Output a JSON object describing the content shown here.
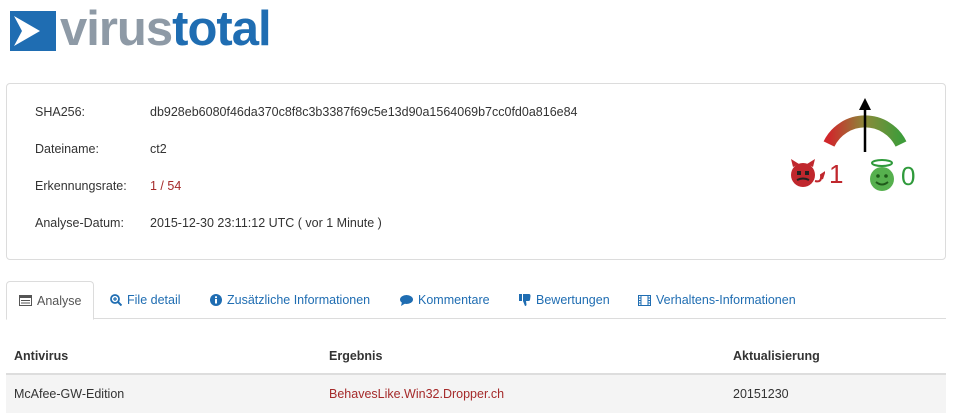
{
  "logo": {
    "text_virus": "virus",
    "text_total": "total"
  },
  "summary": {
    "sha256_label": "SHA256:",
    "sha256_value": "db928eb6080f46da370c8f8c3b3387f69c5e13d90a1564069b7cc0fd0a816e84",
    "filename_label": "Dateiname:",
    "filename_value": "ct2",
    "ratio_label": "Erkennungsrate:",
    "ratio_value": "1 / 54",
    "date_label": "Analyse-Datum:",
    "date_value": "2015-12-30 23:11:12 UTC ( vor 1 Minute )"
  },
  "community": {
    "malicious_votes": "1",
    "harmless_votes": "0",
    "colors": {
      "bad": "#c0272d",
      "good": "#2f9a3b"
    }
  },
  "tabs": [
    {
      "label": "Analyse",
      "icon": "list-icon",
      "active": true
    },
    {
      "label": "File detail",
      "icon": "zoom-icon"
    },
    {
      "label": "Zusätzliche Informationen",
      "icon": "info-icon"
    },
    {
      "label": "Kommentare",
      "icon": "comment-icon"
    },
    {
      "label": "Bewertungen",
      "icon": "thumbs-down-icon"
    },
    {
      "label": "Verhaltens-Informationen",
      "icon": "film-icon"
    }
  ],
  "table": {
    "headers": [
      "Antivirus",
      "Ergebnis",
      "Aktualisierung"
    ],
    "rows": [
      [
        "McAfee-GW-Edition",
        "BehavesLike.Win32.Dropper.ch",
        "20151230"
      ]
    ]
  },
  "colors": {
    "brand_blue": "#1f6db2",
    "brand_gray": "#8e9aa6",
    "link": "#1f6db2",
    "detection": "#a52a2a"
  }
}
